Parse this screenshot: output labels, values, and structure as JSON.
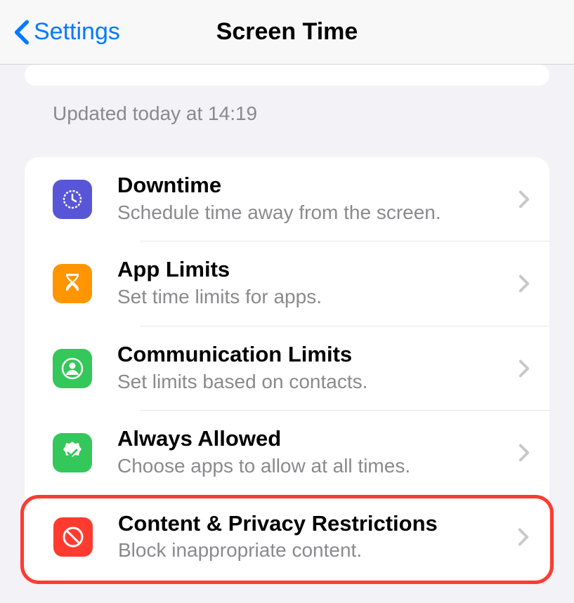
{
  "nav": {
    "back_label": "Settings",
    "title": "Screen Time"
  },
  "updated_text": "Updated today at 14:19",
  "items": [
    {
      "title": "Downtime",
      "subtitle": "Schedule time away from the screen."
    },
    {
      "title": "App Limits",
      "subtitle": "Set time limits for apps."
    },
    {
      "title": "Communication Limits",
      "subtitle": "Set limits based on contacts."
    },
    {
      "title": "Always Allowed",
      "subtitle": "Choose apps to allow at all times."
    },
    {
      "title": "Content & Privacy Restrictions",
      "subtitle": "Block inappropriate content."
    }
  ]
}
